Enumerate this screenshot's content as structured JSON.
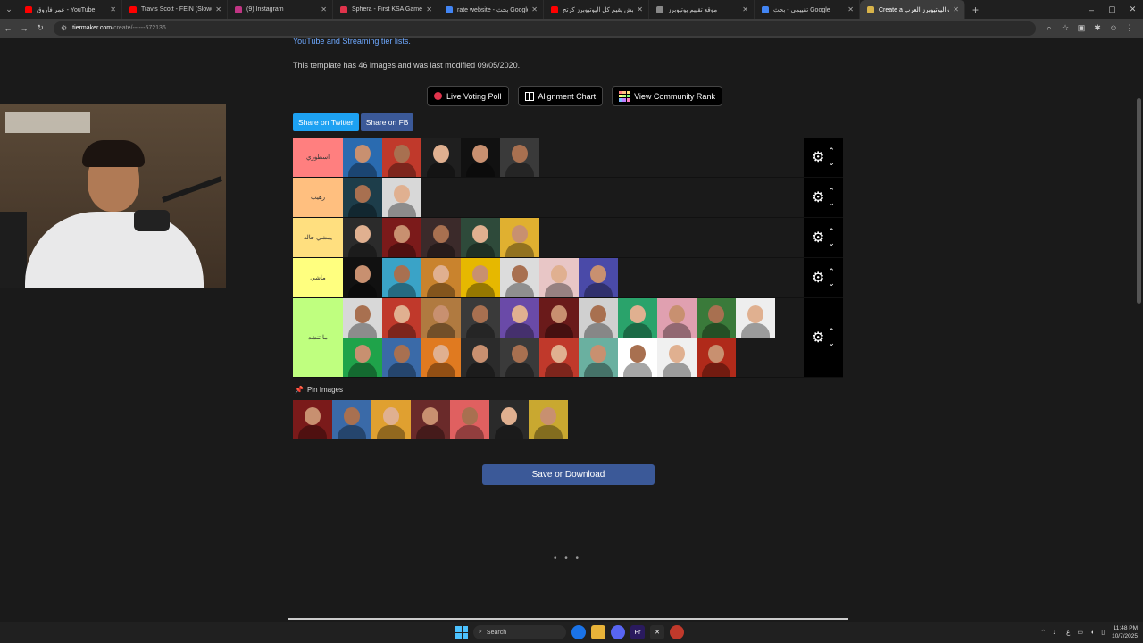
{
  "browser": {
    "tabs": [
      {
        "title": "عمر فاروق - YouTube",
        "fav": "#ff0000",
        "width": 117,
        "active": false
      },
      {
        "title": "Travis Scott - FEIN (Slowed)",
        "fav": "#ff0000",
        "width": 118,
        "active": false
      },
      {
        "title": "(9) Instagram",
        "fav": "#c13584",
        "width": 118,
        "active": false
      },
      {
        "title": "Sphera - First KSA Game Server",
        "fav": "#e0334b",
        "width": 118,
        "active": false
      },
      {
        "title": "rate website - بحث Google",
        "fav": "#4285f4",
        "width": 118,
        "active": false
      },
      {
        "title": "ليش يقيم كل اليوتيوبرز كرتج - he",
        "fav": "#ff0000",
        "width": 118,
        "active": false
      },
      {
        "title": "موقع تقييم يوتيوبرز",
        "fav": "#888888",
        "width": 118,
        "active": false
      },
      {
        "title": "تقييمي - بحث Google",
        "fav": "#4285f4",
        "width": 118,
        "active": false
      },
      {
        "title": "Create a العرب اليوتيوبرز العرب",
        "fav": "#d9b44a",
        "width": 118,
        "active": true
      }
    ],
    "new_tab": "+",
    "url_host": "tiermaker.com",
    "url_path": "/create/------572136"
  },
  "page": {
    "streamer_link": "YouTube and Streaming tier lists.",
    "template_info": "This template has 46 images and was last modified 09/05/2020.",
    "buttons": {
      "live_poll": "Live Voting Poll",
      "alignment": "Alignment Chart",
      "community": "View Community Rank"
    },
    "share_twitter": "Share on Twitter",
    "share_fb": "Share on FB",
    "pin_images": "Pin Images",
    "save_download": "Save or Download",
    "loading": "• • •"
  },
  "tiers": [
    {
      "label": "اسطوري",
      "color": "#ff7f7f",
      "tiles": [
        "#2a6bb0",
        "#c0392b",
        "#1f1f1f",
        "#111111",
        "#3a3a3a"
      ]
    },
    {
      "label": "رهيب",
      "color": "#ffbf7f",
      "tiles": [
        "#1d3d4a",
        "#d8d8d8"
      ]
    },
    {
      "label": "يمشي حاله",
      "color": "#ffdf7f",
      "tiles": [
        "#2b2b2b",
        "#7b1a1a",
        "#3b2a2a",
        "#2e4a3a",
        "#e0b030"
      ]
    },
    {
      "label": "ماشي",
      "color": "#ffff7f",
      "tiles": [
        "#111111",
        "#3aa3c7",
        "#c9832d",
        "#e6b800",
        "#dcdcdc",
        "#e8c6c6",
        "#4a4aa8"
      ]
    },
    {
      "label": "ما تنشد",
      "color": "#bfff7f",
      "tiles": [
        "#d8d8d8",
        "#c0392b",
        "#b07a40",
        "#3a3a3a",
        "#6a4aa8",
        "#6a1a1a",
        "#d0d0d0",
        "#2aa36b",
        "#e0a0b0",
        "#3a7a3a",
        "#eeeeee",
        "#1fa34a",
        "#3a6aa8",
        "#e07a20",
        "#2b2b2b",
        "#3a3a3a",
        "#c0392b",
        "#6ab0a0",
        "#ffffff",
        "#f0f0f0",
        "#b02a1a"
      ]
    }
  ],
  "pool": [
    "#7a1a1a",
    "#3a6aa8",
    "#e0a030",
    "#6a2a2a",
    "#e06060",
    "#2a2a2a",
    "#c9a830"
  ],
  "taskbar": {
    "search": "Search",
    "time": "11:48 PM",
    "date": "10/7/2025",
    "lang": "ع"
  }
}
